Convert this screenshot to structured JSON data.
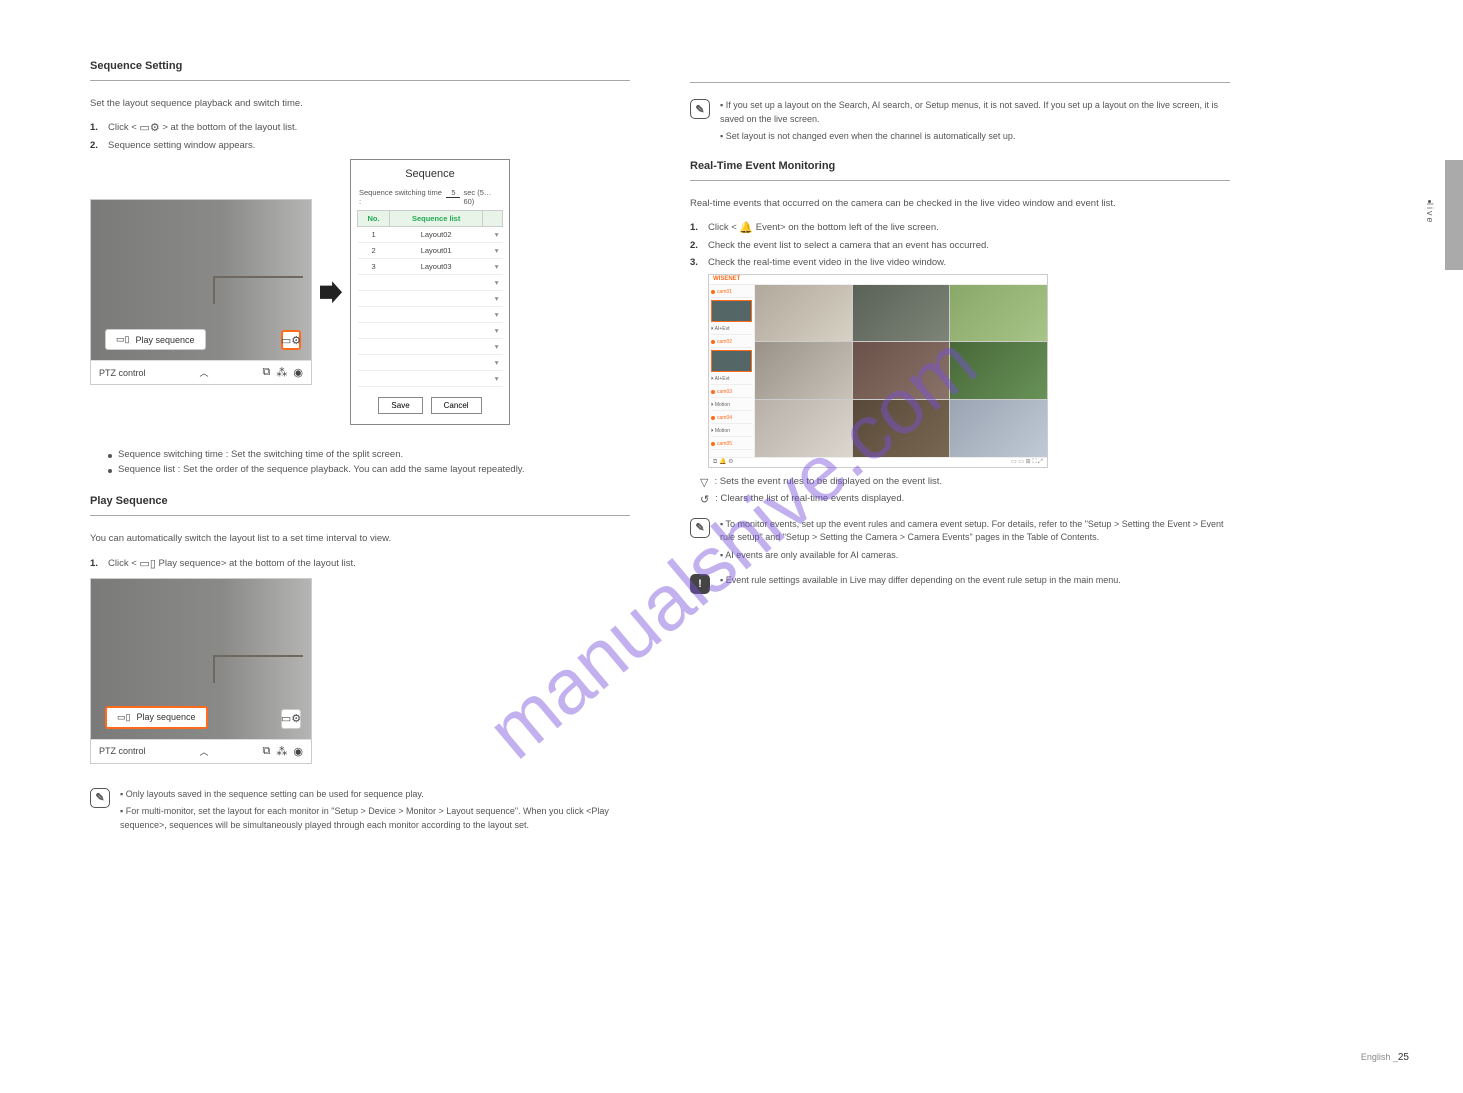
{
  "watermark": "manualshive.com",
  "sideTab": "live",
  "leftCol": {
    "seqSetting": {
      "title": "Sequence Setting",
      "step1a": "Click <",
      "step1b": "> at the bottom of the layout list.",
      "step2": "Sequence setting window appears.",
      "shot": {
        "playBtn": "Play sequence",
        "ptz": "PTZ control",
        "settingsIcon": "⚙"
      },
      "dialog": {
        "title": "Sequence",
        "swLabelLeft": "Sequence switching time :",
        "swValue": "5",
        "swLabelRight": "sec (5…60)",
        "headerNo": "No.",
        "headerList": "Sequence list",
        "rows": [
          {
            "no": "1",
            "name": "Layout02"
          },
          {
            "no": "2",
            "name": "Layout01"
          },
          {
            "no": "3",
            "name": "Layout03"
          }
        ],
        "save": "Save",
        "cancel": "Cancel"
      },
      "bullets": [
        "Sequence switching time : Set the switching time of the split screen.",
        "Sequence list : Set the order of the sequence playback. You can add the same layout repeatedly."
      ]
    },
    "playSeq": {
      "title": "Play Sequence",
      "step1a": "Click <",
      "step1b": "Play sequence> at the bottom of the layout list.",
      "shot": {
        "playBtn": "Play sequence",
        "ptz": "PTZ control"
      },
      "noteItems": [
        "Only layouts saved in the sequence setting can be used for sequence play.",
        "For multi-monitor, set the layout for each monitor in \"Setup > Device > Monitor > Layout sequence\". When you click <Play sequence>, sequences will be simultaneously played through each monitor according to the layout set."
      ]
    }
  },
  "rightCol": {
    "save": {
      "noteA": "If you set up a layout on the Search, AI search, or Setup menus, it is not saved. If you set up a layout on the live screen, it is saved on the live screen.",
      "noteB": "Set layout is not changed even when the channel is automatically set up."
    },
    "event": {
      "title": "Real-Time Event Monitoring",
      "desc": "Real-time events that occurred on the camera can be checked in the live video window and event list.",
      "step1a": "Click <",
      "step1b": "Event> on the bottom left of the live screen.",
      "step2": "Check the event list to select a camera that an event has occurred.",
      "step3": "Check the real-time event video in the live video window.",
      "bigShotLogo": "WISENET",
      "iconLines": [
        ": Sets the event rules to be displayed on the event list.",
        ": Clears the list of real-time events displayed."
      ],
      "noteItems": [
        "To monitor events, set up the event rules and camera event setup. For details, refer to the \"Setup > Setting the Event > Event rule setup\" and \"Setup > Setting the Camera > Camera Events\" pages in the Table of Contents.",
        "AI events are only available for AI cameras."
      ],
      "caution": "Event rule settings available in Live may differ depending on the event rule setup in the main menu."
    }
  },
  "footer": {
    "sep": "|",
    "num": "25",
    "en": "English"
  }
}
